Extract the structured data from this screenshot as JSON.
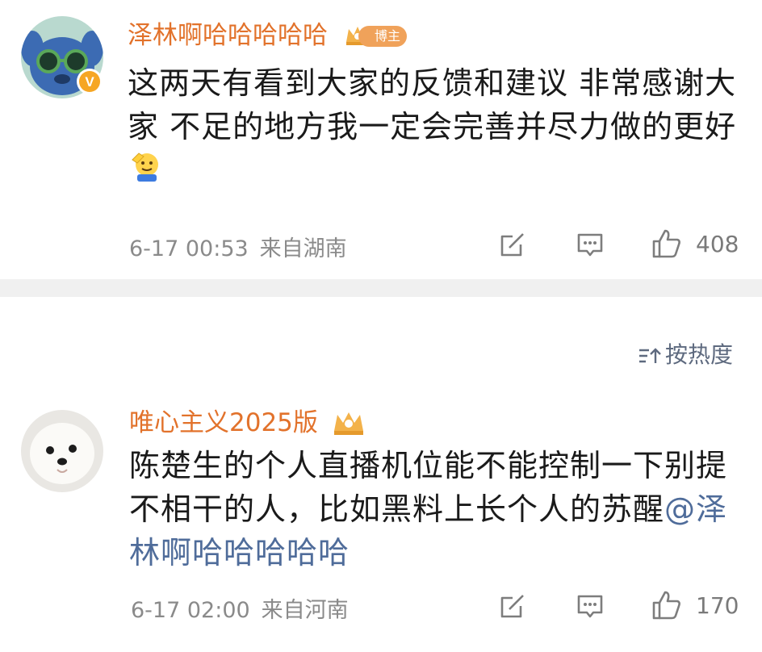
{
  "post": {
    "username": "泽林啊哈哈哈哈哈",
    "badge_label": "博主",
    "content": "这两天有看到大家的反馈和建议 非常感谢大家 不足的地方我一定会完善并尽力做的更好",
    "emoji": "salute-emoji",
    "time": "6-17 00:53",
    "location": "来自湖南",
    "likes": "408",
    "verified_badge": "V"
  },
  "sort": {
    "label": "按热度"
  },
  "comment": {
    "username": "唯心主义2025版",
    "content_text": "陈楚生的个人直播机位能不能控制一下别提不相干的人，比如黑料上长个人的苏醒",
    "mention": "@泽林啊哈哈哈哈哈",
    "time": "6-17 02:00",
    "location": "来自河南",
    "likes": "170"
  },
  "colors": {
    "username": "#e2722b",
    "mention": "#4f6c9a",
    "meta": "#8a8a8a",
    "divider": "#f0f0f0"
  }
}
